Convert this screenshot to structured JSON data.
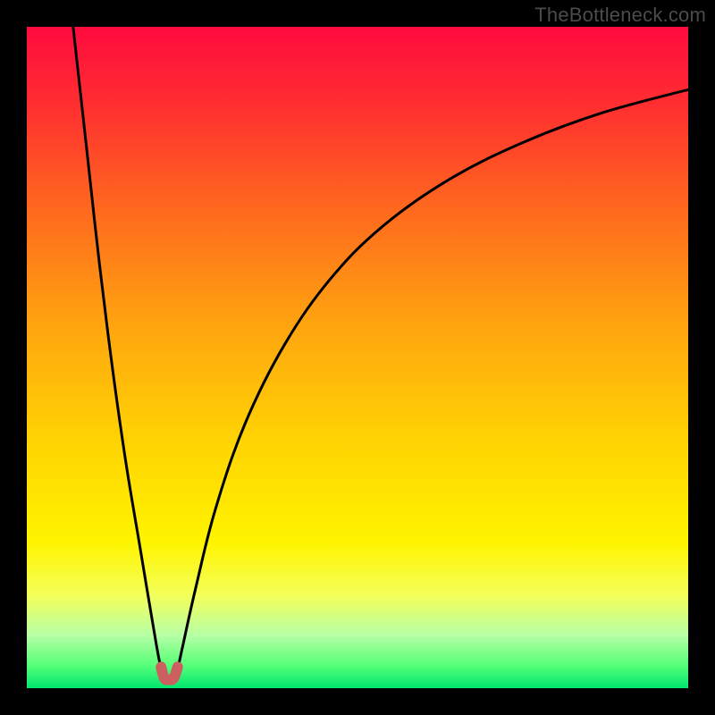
{
  "watermark": "TheBottleneck.com",
  "chart_data": {
    "type": "line",
    "title": "",
    "xlabel": "",
    "ylabel": "",
    "xlim": [
      0,
      100
    ],
    "ylim": [
      0,
      100
    ],
    "grid": false,
    "legend": false,
    "gradient_stops": [
      {
        "offset": 0.0,
        "color": "#ff0b3e"
      },
      {
        "offset": 0.12,
        "color": "#ff2f30"
      },
      {
        "offset": 0.28,
        "color": "#ff6a1e"
      },
      {
        "offset": 0.45,
        "color": "#ffa40f"
      },
      {
        "offset": 0.62,
        "color": "#ffd203"
      },
      {
        "offset": 0.78,
        "color": "#fff400"
      },
      {
        "offset": 0.86,
        "color": "#f3ff5a"
      },
      {
        "offset": 0.92,
        "color": "#b7ffa6"
      },
      {
        "offset": 0.965,
        "color": "#57ff78"
      },
      {
        "offset": 1.0,
        "color": "#00e66f"
      }
    ],
    "series": [
      {
        "name": "bottleneck-curve",
        "color": "#000000",
        "width": 3,
        "points": [
          {
            "x": 7.0,
            "y": 100.0
          },
          {
            "x": 9.0,
            "y": 82.0
          },
          {
            "x": 11.0,
            "y": 64.0
          },
          {
            "x": 13.0,
            "y": 48.0
          },
          {
            "x": 15.0,
            "y": 34.0
          },
          {
            "x": 17.0,
            "y": 22.0
          },
          {
            "x": 18.5,
            "y": 13.0
          },
          {
            "x": 19.6,
            "y": 6.5
          },
          {
            "x": 20.3,
            "y": 3.0
          },
          {
            "x": 21.0,
            "y": 1.3
          },
          {
            "x": 22.0,
            "y": 1.3
          },
          {
            "x": 22.8,
            "y": 3.0
          },
          {
            "x": 23.6,
            "y": 6.5
          },
          {
            "x": 25.5,
            "y": 15.0
          },
          {
            "x": 28.5,
            "y": 27.0
          },
          {
            "x": 33.0,
            "y": 40.0
          },
          {
            "x": 39.0,
            "y": 52.0
          },
          {
            "x": 46.0,
            "y": 62.0
          },
          {
            "x": 54.0,
            "y": 70.0
          },
          {
            "x": 64.0,
            "y": 77.0
          },
          {
            "x": 75.0,
            "y": 82.5
          },
          {
            "x": 87.0,
            "y": 87.0
          },
          {
            "x": 100.0,
            "y": 90.5
          }
        ]
      },
      {
        "name": "highlight-valley",
        "color": "#cc5f5f",
        "width": 12,
        "linecap": "round",
        "points": [
          {
            "x": 20.3,
            "y": 3.2
          },
          {
            "x": 20.8,
            "y": 1.5
          },
          {
            "x": 21.5,
            "y": 1.3
          },
          {
            "x": 22.2,
            "y": 1.5
          },
          {
            "x": 22.8,
            "y": 3.2
          }
        ]
      }
    ]
  }
}
